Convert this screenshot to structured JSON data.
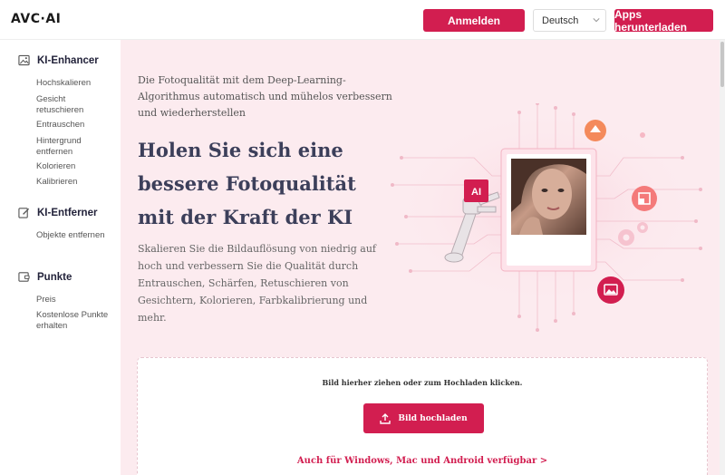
{
  "header": {
    "logo": "AVC·AI",
    "login_label": "Anmelden",
    "language": "Deutsch",
    "apps_label": "Apps herunterladen"
  },
  "sidebar": {
    "sections": [
      {
        "title": "KI-Enhancer",
        "icon": "image-icon",
        "items": [
          "Hochskalieren",
          "Gesicht retuschieren",
          "Entrauschen",
          "Hintergrund entfernen",
          "Kolorieren",
          "Kalibrieren"
        ]
      },
      {
        "title": "KI-Entferner",
        "icon": "edit-icon",
        "items": [
          "Objekte entfernen"
        ]
      },
      {
        "title": "Punkte",
        "icon": "wallet-icon",
        "items": [
          "Preis",
          "Kostenlose Punkte erhalten"
        ]
      }
    ]
  },
  "hero": {
    "intro": "Die Fotoqualität mit dem Deep-Learning-Algorithmus automatisch und mühelos verbessern und wiederherstellen",
    "headline": "Holen Sie sich eine bessere Fotoqualität mit der Kraft der KI",
    "description": "Skalieren Sie die Bildauflösung von niedrig auf hoch und verbessern Sie die Qualität durch Entrauschen, Schärfen, Retuschieren von Gesichtern, Kolorieren, Farbkalibrierung und mehr.",
    "ai_badge": "AI"
  },
  "upload": {
    "hint": "Bild hierher ziehen oder zum Hochladen klicken.",
    "button_label": "Bild hochladen",
    "platform_link": "Auch für Windows, Mac und Android verfügbar >"
  },
  "colors": {
    "accent": "#d21e50",
    "hero_bg": "#fcebef",
    "heading": "#3c3f5a"
  }
}
